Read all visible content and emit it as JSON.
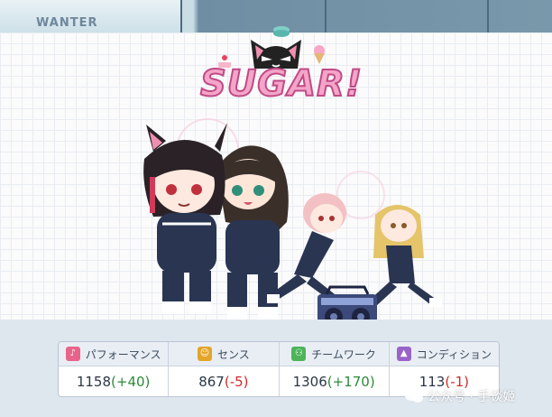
{
  "background": {
    "poster_text": "WANTER"
  },
  "logo": {
    "text": "SUGAR!",
    "colors": {
      "fill": "#f4a5c8",
      "outline": "#c04a86"
    }
  },
  "stats": [
    {
      "label": "パフォーマンス",
      "icon": "microphone-icon",
      "icon_color": "#e8638a",
      "value": "1158",
      "delta": "(+40)",
      "delta_sign": "positive"
    },
    {
      "label": "センス",
      "icon": "face-icon",
      "icon_color": "#e4a52a",
      "value": "867",
      "delta": "(-5)",
      "delta_sign": "negative"
    },
    {
      "label": "チームワーク",
      "icon": "team-icon",
      "icon_color": "#4db45a",
      "value": "1306",
      "delta": "(+170)",
      "delta_sign": "positive"
    },
    {
      "label": "コンディション",
      "icon": "condition-icon",
      "icon_color": "#9a63c9",
      "value": "113",
      "delta": "(-1)",
      "delta_sign": "negative"
    }
  ],
  "watermark": {
    "text": "公众号 · 手谈姬"
  }
}
